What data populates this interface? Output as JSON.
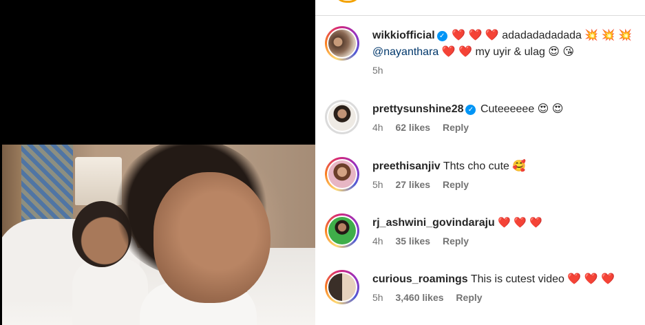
{
  "post": {
    "author": "wikkiofficial",
    "verified": true,
    "caption_line1": "❤️ ❤️ ❤️  adadadadadada 💥 💥 💥",
    "mention": "@nayanthara",
    "caption_line2": " ❤️ ❤️  my uyir & ulag 😍 😘",
    "time": "5h"
  },
  "comments": [
    {
      "username": "prettysunshine28",
      "verified": true,
      "text": "Cuteeeeee 😍 😍",
      "time": "4h",
      "likes": "62 likes",
      "reply": "Reply"
    },
    {
      "username": "preethisanjiv",
      "verified": false,
      "text": "Thts cho cute 🥰",
      "time": "5h",
      "likes": "27 likes",
      "reply": "Reply"
    },
    {
      "username": "rj_ashwini_govindaraju",
      "verified": false,
      "text": "❤️ ❤️ ❤️",
      "time": "4h",
      "likes": "35 likes",
      "reply": "Reply"
    },
    {
      "username": "curious_roamings",
      "verified": false,
      "text": "This is cutest video ❤️ ❤️ ❤️",
      "time": "5h",
      "likes": "3,460 likes",
      "reply": "Reply"
    }
  ],
  "icons": {
    "verified": "verified-badge-icon"
  },
  "colors": {
    "link": "#00376b",
    "meta": "#737373",
    "verified": "#0095f6",
    "heart": "#ed1c3a"
  }
}
